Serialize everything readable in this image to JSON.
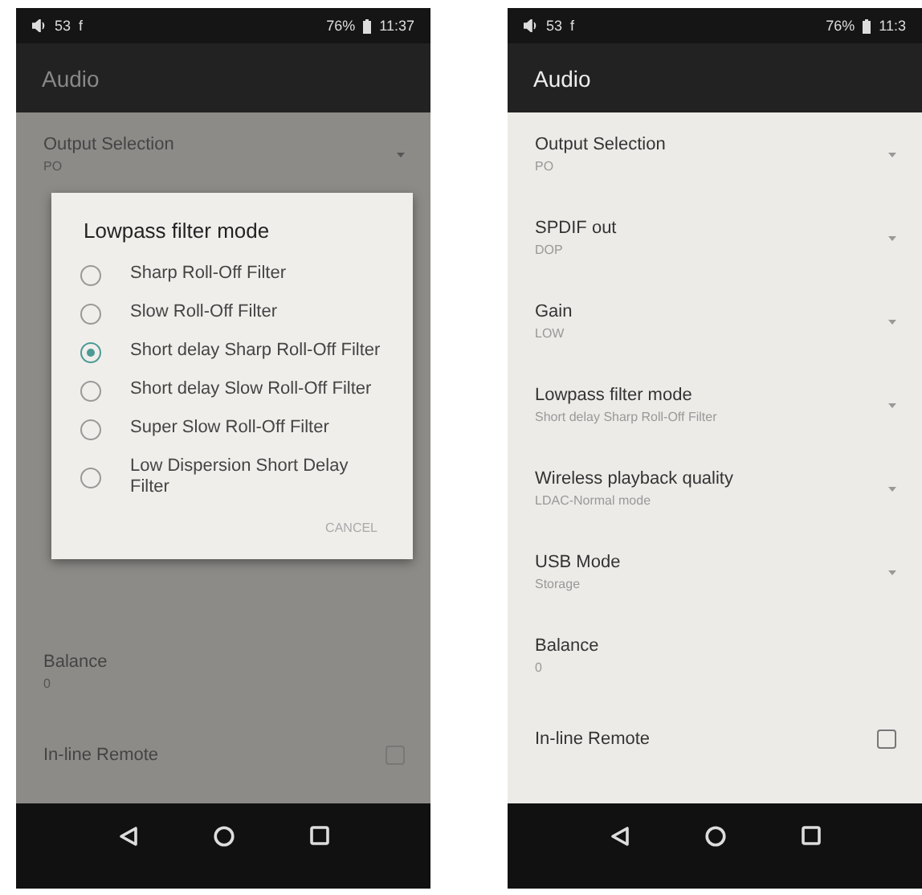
{
  "screens": [
    {
      "status_bar": {
        "volume": "53",
        "notification": "f",
        "battery": "76%",
        "time": "11:37"
      },
      "title": "Audio",
      "dimmed": true,
      "settings": [
        {
          "label": "Output Selection",
          "value": "PO",
          "kind": "dropdown"
        },
        {
          "label": "Balance",
          "value": "0",
          "kind": "value"
        },
        {
          "label": "In-line Remote",
          "kind": "checkbox",
          "checked": false
        }
      ],
      "dialog": {
        "title": "Lowpass filter mode",
        "options": [
          {
            "label": "Sharp Roll-Off Filter",
            "selected": false
          },
          {
            "label": "Slow Roll-Off Filter",
            "selected": false
          },
          {
            "label": "Short delay Sharp Roll-Off Filter",
            "selected": true
          },
          {
            "label": "Short delay Slow Roll-Off Filter",
            "selected": false
          },
          {
            "label": "Super Slow Roll-Off Filter",
            "selected": false
          },
          {
            "label": "Low Dispersion Short Delay Filter",
            "selected": false
          }
        ],
        "button": "CANCEL"
      }
    },
    {
      "status_bar": {
        "volume": "53",
        "notification": "f",
        "battery": "76%",
        "time": "11:3"
      },
      "title": "Audio",
      "dimmed": false,
      "settings": [
        {
          "label": "Output Selection",
          "value": "PO",
          "kind": "dropdown"
        },
        {
          "label": "SPDIF out",
          "value": "DOP",
          "kind": "dropdown"
        },
        {
          "label": "Gain",
          "value": "LOW",
          "kind": "dropdown"
        },
        {
          "label": "Lowpass filter mode",
          "value": "Short delay Sharp Roll-Off Filter",
          "kind": "dropdown"
        },
        {
          "label": "Wireless playback quality",
          "value": "LDAC-Normal mode",
          "kind": "dropdown"
        },
        {
          "label": "USB Mode",
          "value": "Storage",
          "kind": "dropdown"
        },
        {
          "label": "Balance",
          "value": "0",
          "kind": "value"
        },
        {
          "label": "In-line Remote",
          "kind": "checkbox",
          "checked": false
        }
      ]
    }
  ]
}
